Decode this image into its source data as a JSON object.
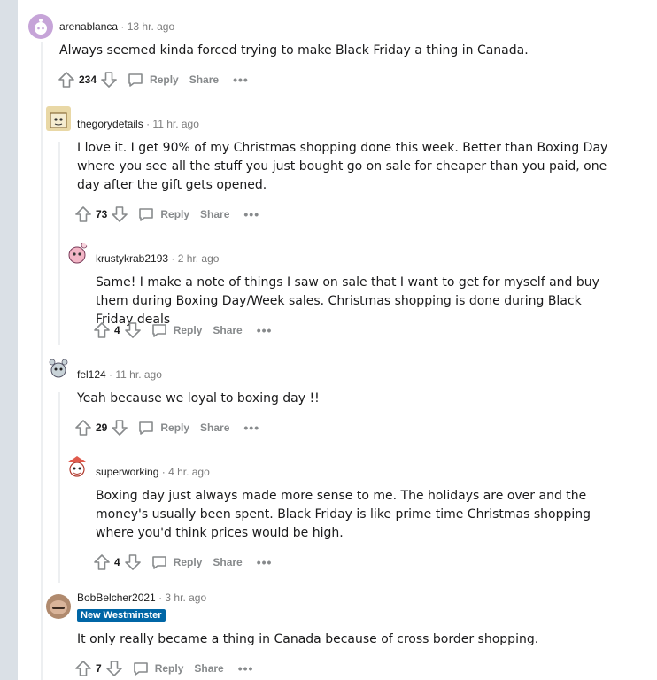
{
  "comments": [
    {
      "username": "arenablanca",
      "time": "13 hr. ago",
      "body": "Always seemed kinda forced trying to make Black Friday a thing in Canada.",
      "score": "234",
      "reply_label": "Reply",
      "share_label": "Share",
      "more_label": "•••",
      "avatar_color": "#c6a4d8"
    },
    {
      "username": "thegorydetails",
      "time": "11 hr. ago",
      "body": "I love it. I get 90% of my Christmas shopping done this week. Better than Boxing Day where you see all the stuff you just bought go on sale for cheaper than you paid, one day after the gift gets opened.",
      "score": "73",
      "reply_label": "Reply",
      "share_label": "Share",
      "more_label": "•••",
      "avatar_color": "#e9d8a6"
    },
    {
      "username": "krustykrab2193",
      "time": "2 hr. ago",
      "body": "Same! I make a note of things I saw on sale that I want to get for myself and buy them during Boxing Day/Week sales. Christmas shopping is done during Black Friday deals",
      "score": "4",
      "reply_label": "Reply",
      "share_label": "Share",
      "more_label": "•••",
      "avatar_color": "#f3b6c6"
    },
    {
      "username": "fel124",
      "time": "11 hr. ago",
      "body": "Yeah because we loyal to boxing day !!",
      "score": "29",
      "reply_label": "Reply",
      "share_label": "Share",
      "more_label": "•••",
      "avatar_color": "#c9d3d8"
    },
    {
      "username": "superworking",
      "time": "4 hr. ago",
      "body": "Boxing day just always made more sense to me. The holidays are over and the money's usually been spent. Black Friday is like prime time Christmas shopping where you'd think prices would be high.",
      "score": "4",
      "reply_label": "Reply",
      "share_label": "Share",
      "more_label": "•••",
      "avatar_color": "#e05a4c"
    },
    {
      "username": "BobBelcher2021",
      "time": "3 hr. ago",
      "flair": "New Westminster",
      "body": "It only really became a thing in Canada because of cross border shopping.",
      "score": "7",
      "reply_label": "Reply",
      "share_label": "Share",
      "more_label": "•••",
      "avatar_color": "#b08a6e"
    }
  ],
  "separator": "·",
  "colors": {
    "flair_bg": "#0066a6",
    "thread_line": "#edeff1",
    "page_bg": "#dae0e6"
  }
}
